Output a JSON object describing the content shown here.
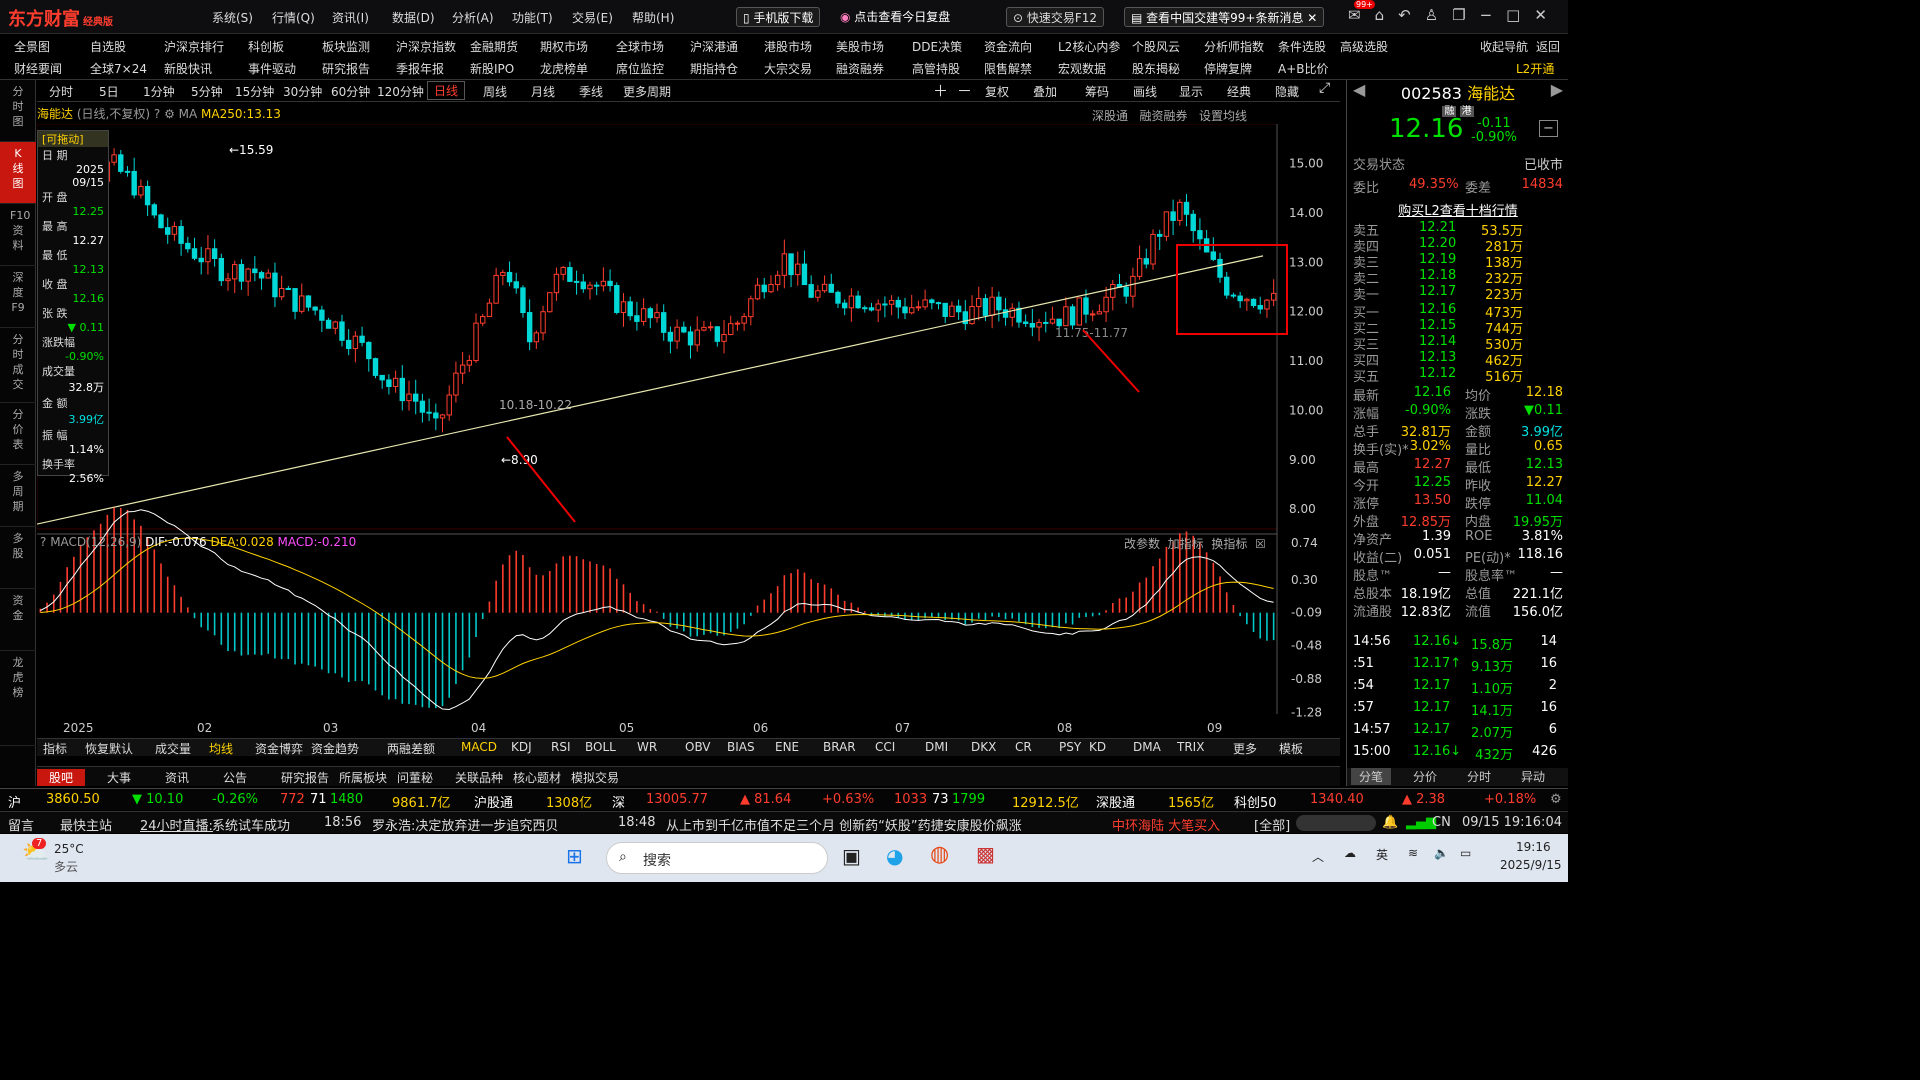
{
  "app": {
    "logo": "东方财富",
    "edition": "经典版"
  },
  "menu": [
    "系统(S)",
    "行情(Q)",
    "资讯(I)",
    "数据(D)",
    "分析(A)",
    "功能(T)",
    "交易(E)",
    "帮助(H)"
  ],
  "title_buttons": {
    "mobile": "手机版下载",
    "review": "点击查看今日复盘",
    "quick_trade": "快速交易F12",
    "news": "查看中国交建等99+条新消息",
    "badge": "99+"
  },
  "menu2_row1": [
    "全景图",
    "自选股",
    "沪深京排行",
    "科创板",
    "板块监测",
    "沪深京指数",
    "金融期货",
    "期权市场",
    "全球市场",
    "沪深港通",
    "港股市场",
    "美股市场",
    "DDE决策",
    "资金流向",
    "L2核心内参",
    "个股风云",
    "分析师指数",
    "条件选股",
    "高级选股",
    "收起导航",
    "返回"
  ],
  "menu2_row2": [
    "财经要闻",
    "全球7×24",
    "新股快讯",
    "事件驱动",
    "研究报告",
    "季报年报",
    "新股IPO",
    "龙虎榜单",
    "席位监控",
    "期指持仓",
    "大宗交易",
    "融资融券",
    "高管持股",
    "限售解禁",
    "宏观数据",
    "股东揭秘",
    "停牌复牌",
    "A+B比价",
    "L2开通"
  ],
  "leftnav": [
    "分时图",
    "K线图",
    "F10资料",
    "深度F9",
    "分时成交",
    "分价表",
    "多周期",
    "多股",
    "资金",
    "龙虎榜"
  ],
  "periods": [
    "分时",
    "5日",
    "1分钟",
    "5分钟",
    "15分钟",
    "30分钟",
    "60分钟",
    "120分钟",
    "日线",
    "周线",
    "月线",
    "季线",
    "更多周期"
  ],
  "tools": [
    "复权",
    "叠加",
    "筹码",
    "画线",
    "显示",
    "经典",
    "隐藏"
  ],
  "chart_header": {
    "name": "海能达",
    "mode": "(日线,不复权)",
    "ma_label": "MA",
    "ma_value": "MA250:13.13",
    "links": [
      "深股通",
      "融资融券",
      "设置均线"
    ]
  },
  "info_box": {
    "drag": "[可拖动]",
    "date_label": "日 期",
    "year": "2025",
    "date": "09/15",
    "open_label": "开 盘",
    "open": "12.25",
    "high_label": "最 高",
    "high": "12.27",
    "low_label": "最 低",
    "low": "12.13",
    "close_label": "收 盘",
    "close": "12.16",
    "chg_label": "张 跌",
    "chg": "▼ 0.11",
    "pct_label": "涨跌幅",
    "pct": "-0.90%",
    "vol_label": "成交量",
    "vol": "32.8万",
    "amt_label": "金 额",
    "amt": "3.99亿",
    "amp_label": "振 幅",
    "amp": "1.14%",
    "turn_label": "换手率",
    "turn": "2.56%"
  },
  "chart_data": {
    "type": "candlestick",
    "price_ylim": [
      7.6,
      15.8
    ],
    "price_ticks": [
      "15.00",
      "14.00",
      "13.00",
      "12.00",
      "11.00",
      "10.00",
      "9.00",
      "8.00"
    ],
    "months": [
      "2025",
      "02",
      "03",
      "04",
      "05",
      "06",
      "07",
      "08",
      "09"
    ],
    "annotations": [
      "←15.59",
      "10.18-10.22",
      "←8.90",
      "11.75-11.77"
    ],
    "ma250_range": [
      7.7,
      13.13
    ],
    "macd": {
      "label": "MACD(12,26,9)",
      "dif": "DIF:-0.076",
      "dea": "DEA:0.028",
      "macd": "MACD:-0.210",
      "ticks": [
        "0.74",
        "0.30",
        "-0.09",
        "-0.48",
        "-0.88",
        "-1.28"
      ],
      "ylim": [
        -1.3,
        0.85
      ]
    }
  },
  "macd_links": [
    "改参数",
    "加指标",
    "换指标"
  ],
  "indicators": [
    "指标",
    "恢复默认",
    "成交量",
    "均线",
    "资金博弈",
    "资金趋势",
    "两融差额",
    "MACD",
    "KDJ",
    "RSI",
    "BOLL",
    "WR",
    "OBV",
    "BIAS",
    "ENE",
    "BRAR",
    "CCI",
    "DMI",
    "DKX",
    "CR",
    "PSY",
    "KD",
    "DMA",
    "TRIX",
    "更多",
    "模板"
  ],
  "bottom_tabs": [
    "股吧",
    "大事",
    "资讯",
    "公告",
    "研究报告",
    "所属板块",
    "问董秘",
    "关联品种",
    "核心题材",
    "模拟交易"
  ],
  "quote": {
    "code": "002583",
    "name": "海能达",
    "tags": [
      "融",
      "港"
    ],
    "price": "12.16",
    "chg": "-0.11",
    "pct": "-0.90%",
    "state_label": "交易状态",
    "state": "已收市",
    "wb_label": "委比",
    "wb": "49.35%",
    "wc_label": "委差",
    "wc": "14834",
    "l2": "购买L2查看十档行情",
    "asks": [
      [
        "卖五",
        "12.21",
        "53.5万"
      ],
      [
        "卖四",
        "12.20",
        "281万"
      ],
      [
        "卖三",
        "12.19",
        "138万"
      ],
      [
        "卖二",
        "12.18",
        "232万"
      ],
      [
        "卖一",
        "12.17",
        "223万"
      ]
    ],
    "bids": [
      [
        "买一",
        "12.16",
        "473万"
      ],
      [
        "买二",
        "12.15",
        "744万"
      ],
      [
        "买三",
        "12.14",
        "530万"
      ],
      [
        "买四",
        "12.13",
        "462万"
      ],
      [
        "买五",
        "12.12",
        "516万"
      ]
    ],
    "stats": [
      [
        "最新",
        "12.16",
        "均价",
        "12.18"
      ],
      [
        "涨幅",
        "-0.90%",
        "涨跌",
        "▼0.11"
      ],
      [
        "总手",
        "32.81万",
        "金额",
        "3.99亿"
      ],
      [
        "换手(实)*",
        "3.02%",
        "量比",
        "0.65"
      ],
      [
        "最高",
        "12.27",
        "最低",
        "12.13"
      ],
      [
        "今开",
        "12.25",
        "昨收",
        "12.27"
      ],
      [
        "涨停",
        "13.50",
        "跌停",
        "11.04"
      ],
      [
        "外盘",
        "12.85万",
        "内盘",
        "19.95万"
      ],
      [
        "净资产",
        "1.39",
        "ROE",
        "3.81%"
      ],
      [
        "收益(二)",
        "0.051",
        "PE(动)*",
        "118.16"
      ],
      [
        "股息™",
        "—",
        "股息率™",
        "—"
      ],
      [
        "总股本",
        "18.19亿",
        "总值",
        "221.1亿"
      ],
      [
        "流通股",
        "12.83亿",
        "流值",
        "156.0亿"
      ]
    ],
    "ticks": [
      [
        "14:56",
        "12.16↓",
        "15.8万",
        "14"
      ],
      [
        ":51",
        "12.17↑",
        "9.13万",
        "16"
      ],
      [
        ":54",
        "12.17",
        "1.10万",
        "2"
      ],
      [
        ":57",
        "12.17",
        "14.1万",
        "16"
      ],
      [
        "14:57",
        "12.17",
        "2.07万",
        "6"
      ],
      [
        "15:00",
        "12.16↓",
        "432万",
        "426"
      ]
    ],
    "tabs": [
      "分笔",
      "分价",
      "分时",
      "异动"
    ]
  },
  "status": {
    "sh": "沪",
    "sh_idx": "3860.50",
    "sh_chg": "▼ 10.10",
    "sh_pct": "-0.26%",
    "sh_up": "772",
    "sh_flat": "71",
    "sh_dn": "1480",
    "sh_amt": "9861.7亿",
    "hgt": "沪股通",
    "hgt_v": "1308亿",
    "sz": "深",
    "sz_idx": "13005.77",
    "sz_chg": "▲ 81.64",
    "sz_pct": "+0.63%",
    "sz_up": "1033",
    "sz_flat": "73",
    "sz_dn": "1799",
    "sz_amt": "12912.5亿",
    "sgt": "深股通",
    "sgt_v": "1565亿",
    "kc": "科创50",
    "kc_idx": "1340.40",
    "kc_chg": "▲ 2.38",
    "kc_pct": "+0.18%"
  },
  "ticker": {
    "msg": "留言",
    "fast": "最快主站",
    "live": "24小时直播:",
    "live_txt": "系统试车成功",
    "t1": "18:56",
    "n1": "罗永浩:决定放弃进一步追究西贝",
    "t2": "18:48",
    "n2": "从上市到千亿市值不足三个月 创新药“妖股”药捷安康股价飙涨",
    "hot": "中环海陆 大笔买入",
    "all": "[全部]",
    "lang": "CN",
    "dt": "09/15 19:16:04"
  },
  "taskbar": {
    "temp": "25°C",
    "weather": "多云",
    "alert": "7",
    "search": "搜索",
    "ime": "英",
    "time": "19:16",
    "date": "2025/9/15"
  }
}
